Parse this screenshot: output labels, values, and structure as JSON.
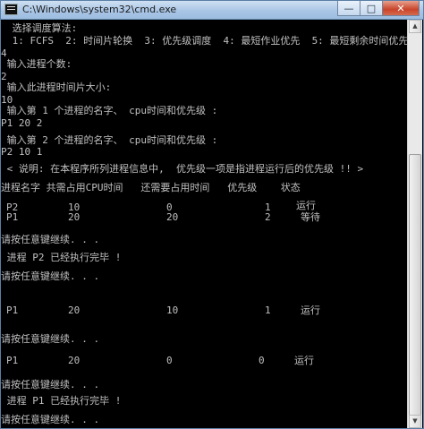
{
  "window": {
    "title": "C:\\Windows\\system32\\cmd.exe",
    "icon": "console-icon",
    "controls": {
      "minimize": "—",
      "maximize": "□",
      "close": "✕"
    }
  },
  "console": {
    "lines": [
      " 选择调度算法:",
      " 1: FCFS  2: 时间片轮换  3: 优先级调度  4: 最短作业优先  5: 最短剩余时间优先",
      "4",
      " 输入进程个数:",
      "2",
      " 输入此进程时间片大小:",
      "10",
      " 输入第 1 个进程的名字、 cpu时间和优先级 :",
      "P1 20 2",
      " 输入第 2 个进程的名字、 cpu时间和优先级 :",
      "P2 10 1",
      " < 说明: 在本程序所列进程信息中,  优先级一项是指进程运行后的优先级 !! >",
      "进程名字 共需占用CPU时间   还需要占用时间   优先级    状态"
    ],
    "table1": [
      [
        "P2",
        "10",
        "0",
        "1",
        "运行"
      ],
      [
        "P1",
        "20",
        "20",
        "2",
        "等待"
      ]
    ],
    "press_any_key_1": "请按任意键继续. . .",
    "done_p2": " 进程 P2 已经执行完毕 !",
    "press_any_key_2": "请按任意键继续. . .",
    "table2": [
      [
        "P1",
        "20",
        "10",
        "1",
        "运行"
      ]
    ],
    "press_any_key_3": "请按任意键继续. . .",
    "table3": [
      [
        "P1",
        "20",
        "0",
        "0",
        "运行"
      ]
    ],
    "press_any_key_4": "请按任意键继续. . .",
    "done_p1": " 进程 P1 已经执行完毕 !",
    "press_any_key_5": "请按任意键继续. . ."
  },
  "colors": {
    "console_bg": "#000000",
    "console_text": "#c0c0c0",
    "titlebar": "#a9c6e6",
    "close": "#c8452a"
  }
}
